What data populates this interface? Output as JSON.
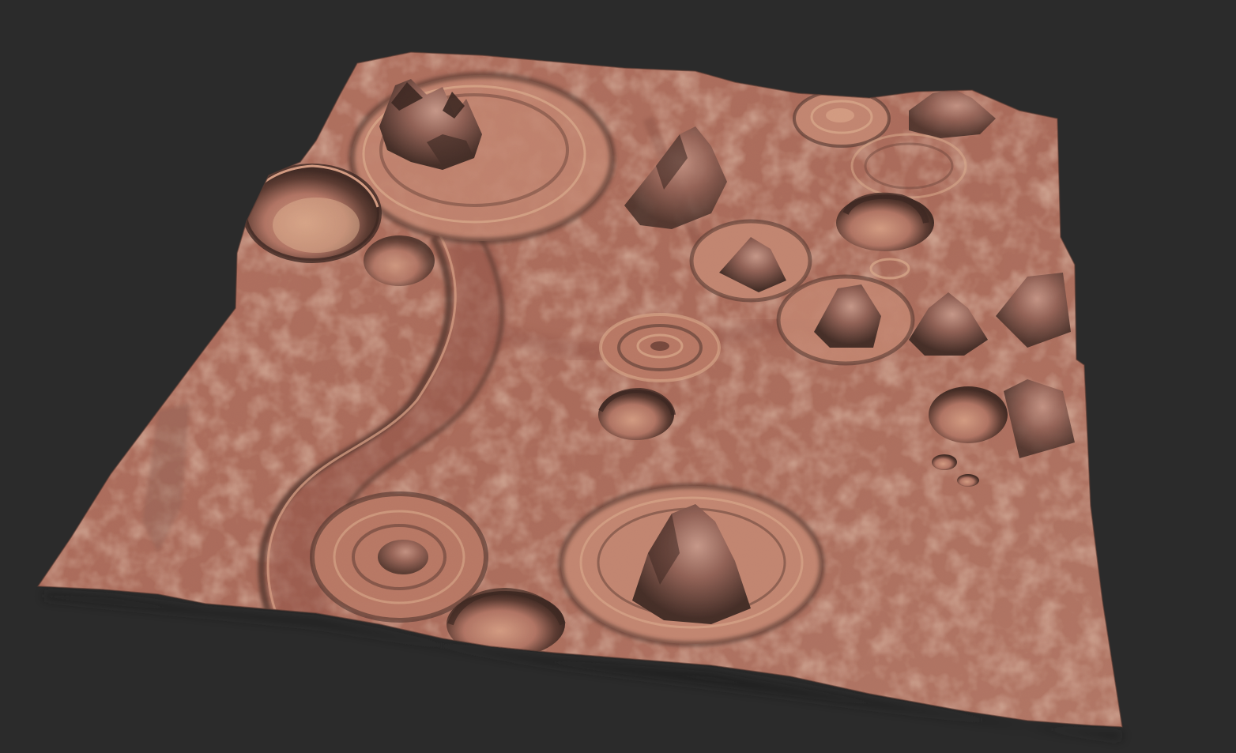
{
  "scene": {
    "background_color": "#2b2b2b",
    "subject": "terrain-heightmap-render",
    "palette": {
      "base": "#a8685a",
      "mid": "#b97a68",
      "light": "#d9a48a",
      "sand": "#e2b897",
      "shadow": "#3a2824",
      "deep_shadow": "#241816",
      "channel": "#8a4c42"
    }
  }
}
